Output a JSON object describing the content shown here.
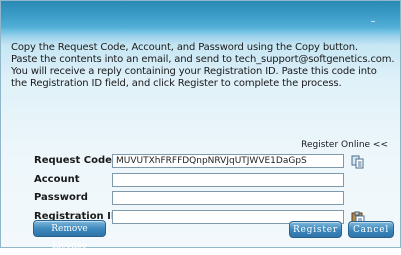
{
  "title_bar": {
    "minimize_glyph": "–"
  },
  "instructions": [
    "Copy the Request Code, Account, and Password using the Copy button.",
    "Paste the contents into an email, and send to tech_support@softgenetics.com.",
    "You will receive a reply containing your Registration ID. Paste this code into",
    "the Registration ID field, and click Register to complete the process."
  ],
  "register_online_label": "Register Online <<",
  "fields": {
    "request_code": {
      "label": "Request Code",
      "value": "MUVUTXhFRFFDQnpNRVJqUTJWVE1DaGpS"
    },
    "account": {
      "label": "Account",
      "value": ""
    },
    "password": {
      "label": "Password",
      "value": ""
    },
    "registration_id": {
      "label": "Registration ID",
      "value": ""
    }
  },
  "buttons": {
    "remove_license": "Remove License",
    "register": "Register",
    "cancel": "Cancel"
  },
  "icons": {
    "copy": "copy-icon",
    "paste": "paste-icon"
  }
}
